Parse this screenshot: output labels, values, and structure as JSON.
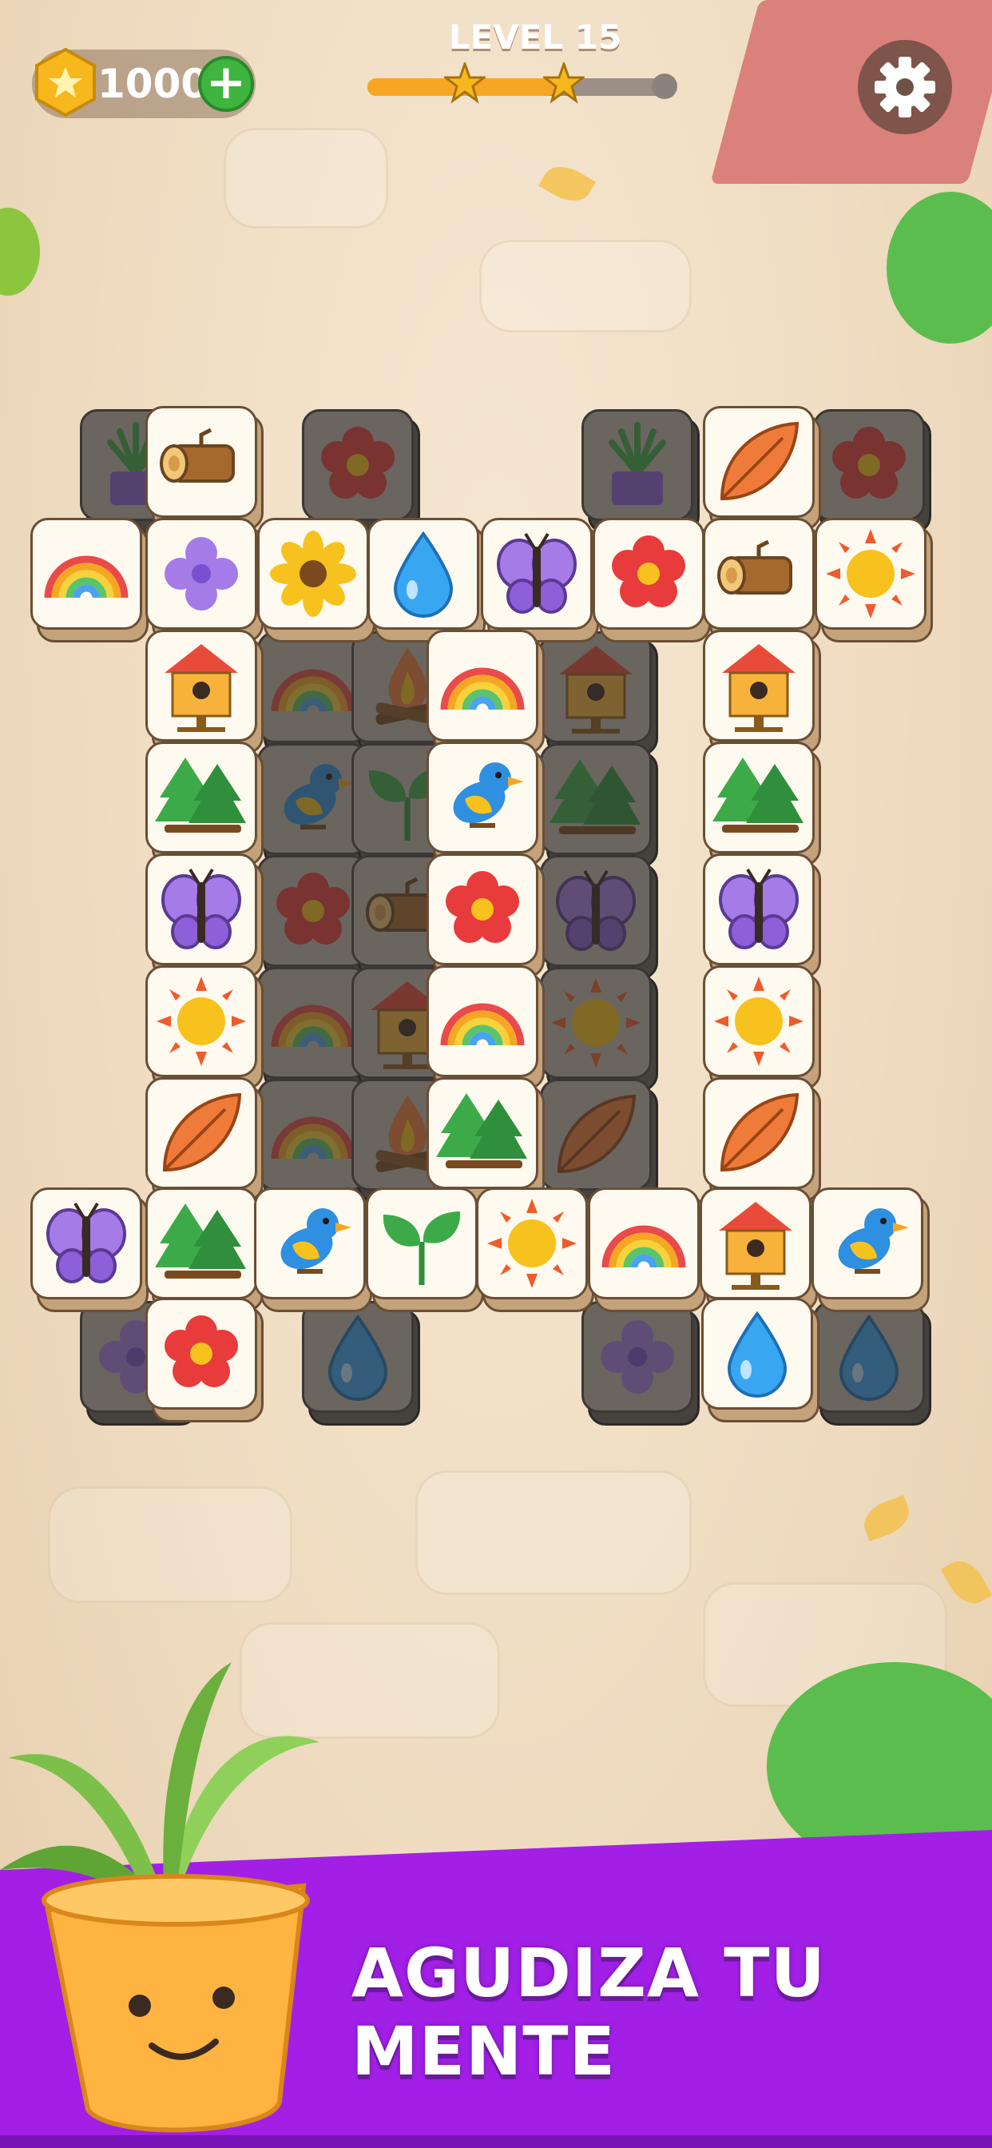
{
  "hud": {
    "coins": "1000",
    "add_coins_symbol": "+",
    "level_label": "LEVEL 15",
    "progress_fraction": 0.62,
    "stars_earned": 2,
    "settings_icon": "gear-icon"
  },
  "colors": {
    "banner_purple": "#a21fe6",
    "tile_face": "#fffaf0",
    "tile_border": "#6a4e35",
    "coin_gold": "#f7b81d",
    "plus_green": "#3fb43f"
  },
  "banner": {
    "text": "AGUDIZA TU MENTE"
  },
  "tiles": [
    {
      "icon": "plant",
      "layer": "low"
    },
    {
      "icon": "log",
      "layer": "top"
    },
    {
      "icon": "flower-red",
      "layer": "low"
    },
    {
      "icon": "plant",
      "layer": "low"
    },
    {
      "icon": "leaf",
      "layer": "top"
    },
    {
      "icon": "flower-red",
      "layer": "low"
    },
    {
      "icon": "rainbow",
      "layer": "top"
    },
    {
      "icon": "flower-purple",
      "layer": "top"
    },
    {
      "icon": "sunflower",
      "layer": "top"
    },
    {
      "icon": "drop",
      "layer": "top"
    },
    {
      "icon": "butterfly",
      "layer": "top"
    },
    {
      "icon": "flower-red",
      "layer": "top"
    },
    {
      "icon": "log",
      "layer": "top"
    },
    {
      "icon": "sun",
      "layer": "top"
    },
    {
      "icon": "birdhouse",
      "layer": "top"
    },
    {
      "icon": "rainbow",
      "layer": "low"
    },
    {
      "icon": "campfire",
      "layer": "low"
    },
    {
      "icon": "rainbow",
      "layer": "top"
    },
    {
      "icon": "birdhouse",
      "layer": "low"
    },
    {
      "icon": "birdhouse",
      "layer": "top"
    },
    {
      "icon": "trees",
      "layer": "top"
    },
    {
      "icon": "bird",
      "layer": "low"
    },
    {
      "icon": "sprout",
      "layer": "low"
    },
    {
      "icon": "bird",
      "layer": "top"
    },
    {
      "icon": "trees",
      "layer": "low"
    },
    {
      "icon": "trees",
      "layer": "top"
    },
    {
      "icon": "butterfly",
      "layer": "top"
    },
    {
      "icon": "flower-red",
      "layer": "low"
    },
    {
      "icon": "log",
      "layer": "low"
    },
    {
      "icon": "flower-red",
      "layer": "top"
    },
    {
      "icon": "butterfly",
      "layer": "low"
    },
    {
      "icon": "butterfly",
      "layer": "top"
    },
    {
      "icon": "sun",
      "layer": "top"
    },
    {
      "icon": "rainbow",
      "layer": "low"
    },
    {
      "icon": "birdhouse",
      "layer": "low"
    },
    {
      "icon": "rainbow",
      "layer": "top"
    },
    {
      "icon": "sun",
      "layer": "low"
    },
    {
      "icon": "sun",
      "layer": "top"
    },
    {
      "icon": "leaf",
      "layer": "top"
    },
    {
      "icon": "rainbow",
      "layer": "low"
    },
    {
      "icon": "campfire",
      "layer": "low"
    },
    {
      "icon": "trees",
      "layer": "top"
    },
    {
      "icon": "leaf",
      "layer": "low"
    },
    {
      "icon": "leaf",
      "layer": "top"
    },
    {
      "icon": "butterfly",
      "layer": "top"
    },
    {
      "icon": "trees",
      "layer": "top"
    },
    {
      "icon": "bird",
      "layer": "top"
    },
    {
      "icon": "sprout",
      "layer": "top"
    },
    {
      "icon": "sun",
      "layer": "top"
    },
    {
      "icon": "rainbow",
      "layer": "top"
    },
    {
      "icon": "birdhouse",
      "layer": "top"
    },
    {
      "icon": "bird",
      "layer": "top"
    },
    {
      "icon": "flower-purple",
      "layer": "low"
    },
    {
      "icon": "flower-red",
      "layer": "top"
    },
    {
      "icon": "drop",
      "layer": "low"
    },
    {
      "icon": "flower-purple",
      "layer": "low"
    },
    {
      "icon": "drop",
      "layer": "top"
    },
    {
      "icon": "drop",
      "layer": "low"
    }
  ]
}
